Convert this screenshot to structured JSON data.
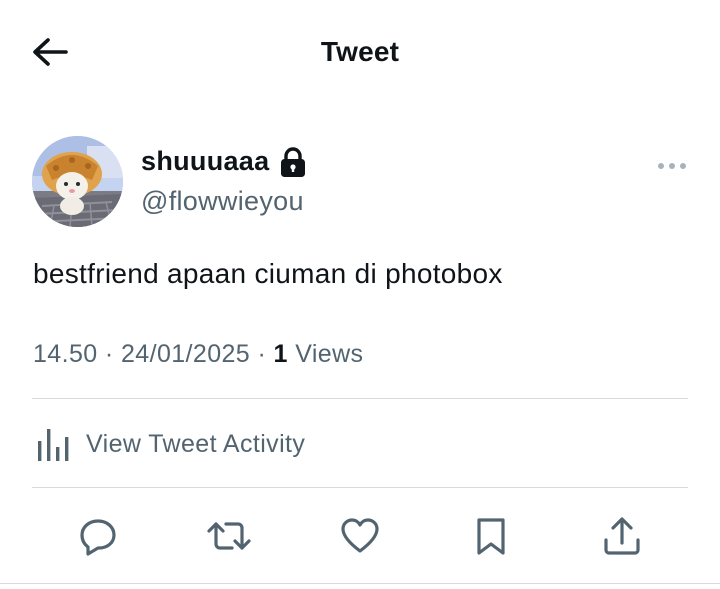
{
  "header": {
    "back_icon": "arrow-left-icon",
    "title": "Tweet"
  },
  "author": {
    "display_name": "shuuuaaa",
    "handle": "@flowwieyou",
    "protected_icon": "lock-icon",
    "more_icon": "more-horizontal-icon"
  },
  "tweet": {
    "text": "bestfriend apaan ciuman di photobox",
    "time": "14.50",
    "date": "24/01/2025",
    "views_count": "1",
    "views_label": "Views"
  },
  "activity": {
    "icon": "bar-chart-icon",
    "label": "View Tweet Activity"
  },
  "actions": [
    {
      "name": "reply",
      "icon": "reply-icon"
    },
    {
      "name": "retweet",
      "icon": "retweet-icon"
    },
    {
      "name": "like",
      "icon": "heart-icon"
    },
    {
      "name": "bookmark",
      "icon": "bookmark-icon"
    },
    {
      "name": "share",
      "icon": "share-icon"
    }
  ],
  "colors": {
    "text_primary": "#0f1419",
    "text_secondary": "#536471",
    "divider": "#d6dadd",
    "background": "#ffffff"
  }
}
